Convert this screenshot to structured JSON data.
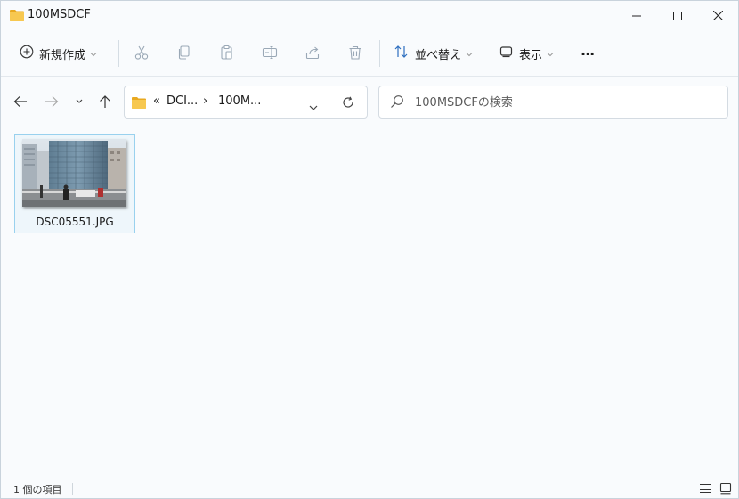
{
  "window": {
    "title": "100MSDCF",
    "controls": [
      "minimize-icon",
      "maximize-icon",
      "close-icon"
    ]
  },
  "toolbar": {
    "new_label": "新規作成",
    "sort_label": "並べ替え",
    "view_label": "表示",
    "more_label": "···",
    "icons": [
      "cut-icon",
      "copy-icon",
      "paste-icon",
      "rename-icon",
      "share-icon",
      "delete-icon"
    ]
  },
  "address": {
    "overflow": "«",
    "path": [
      "DCI...",
      "100M..."
    ],
    "separator": "›"
  },
  "search": {
    "placeholder": "100MSDCFの検索"
  },
  "files": [
    {
      "name": "DSC05551.JPG"
    }
  ],
  "status": {
    "count_text": "1 個の項目"
  },
  "colors": {
    "folder": "#f4c44e",
    "selection_border": "#99d1ee",
    "selection_bg": "#eef6fb",
    "background": "#f9fbfd"
  }
}
